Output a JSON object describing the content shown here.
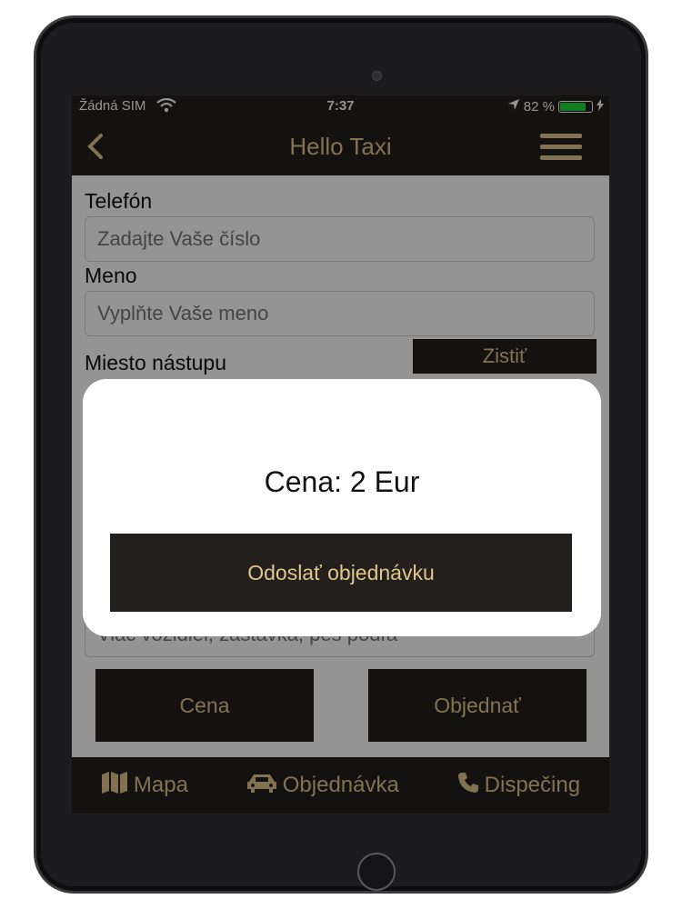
{
  "status_bar": {
    "carrier": "Žádná SIM",
    "time": "7:37",
    "battery_percent": "82 %",
    "battery_level": 0.82,
    "battery_color": "#1fd641"
  },
  "nav": {
    "title": "Hello Taxi",
    "back_icon": "chevron-left-icon",
    "menu_icon": "hamburger-menu-icon"
  },
  "form": {
    "phone": {
      "label": "Telefón",
      "placeholder": "Zadajte Vaše číslo",
      "value": ""
    },
    "name": {
      "label": "Meno",
      "placeholder": "Vyplňte Vaše meno",
      "value": ""
    },
    "pickup": {
      "label": "Miesto nástupu",
      "locate_button": "Zistiť"
    },
    "note": {
      "placeholder": "Viac vozidiel, zastávka, pes podľa"
    }
  },
  "actions": {
    "price_button": "Cena",
    "order_button": "Objednať"
  },
  "dialog": {
    "price_label": "Cena:",
    "price_value": "2 Eur",
    "submit_button": "Odoslať objednávku"
  },
  "tabbar": {
    "items": [
      {
        "label": "Mapa",
        "icon": "map-icon"
      },
      {
        "label": "Objednávka",
        "icon": "car-icon"
      },
      {
        "label": "Dispečing",
        "icon": "phone-icon"
      }
    ]
  },
  "colors": {
    "bar_background": "#231f1c",
    "accent_gold": "#e0c58c",
    "overlay": "rgba(0,0,0,0.42)"
  }
}
